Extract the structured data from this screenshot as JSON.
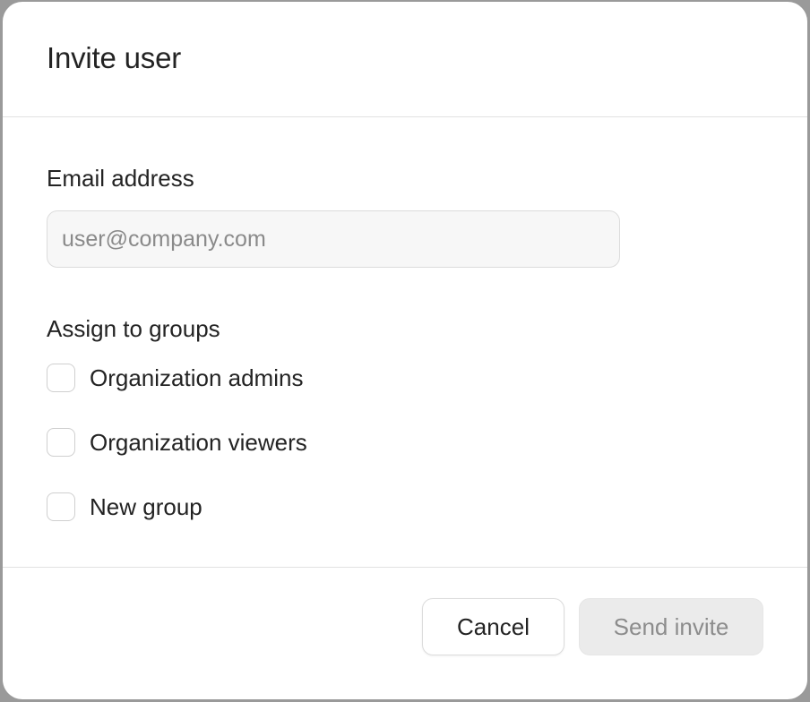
{
  "dialog": {
    "title": "Invite user"
  },
  "email": {
    "label": "Email address",
    "placeholder": "user@company.com",
    "value": ""
  },
  "groups": {
    "label": "Assign to groups",
    "options": [
      {
        "label": "Organization admins",
        "checked": false
      },
      {
        "label": "Organization viewers",
        "checked": false
      },
      {
        "label": "New group",
        "checked": false
      }
    ]
  },
  "footer": {
    "cancel_label": "Cancel",
    "send_label": "Send invite",
    "send_disabled": true
  }
}
